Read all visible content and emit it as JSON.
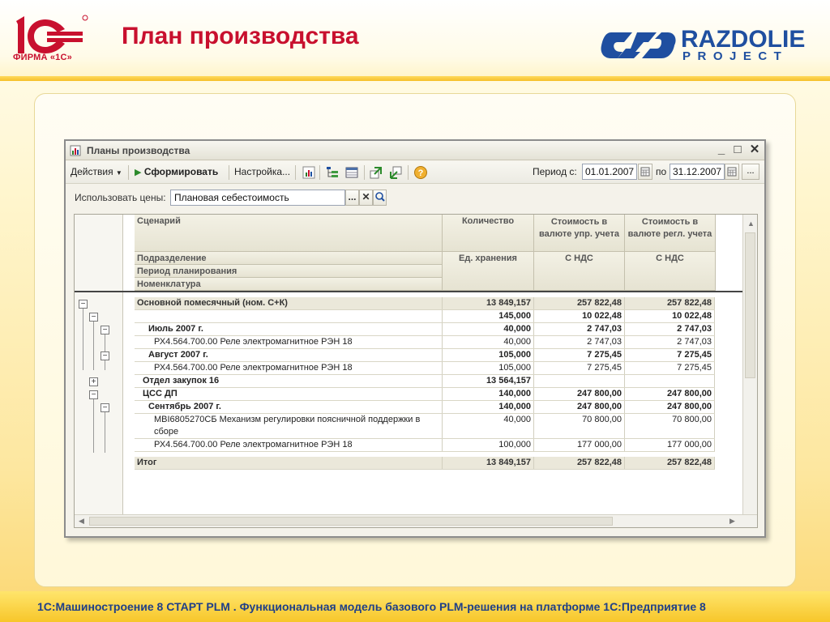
{
  "slide": {
    "brand_caption": "ФИРМА «1С»",
    "title": "План производства",
    "partner_name": "RAZDOLIE",
    "partner_sub": "PROJECT",
    "footer": "1С:Машиностроение 8 СТАРТ PLM . Функциональная модель базового PLM-решения на платформе  1С:Предприятие 8"
  },
  "window": {
    "title": "Планы производства",
    "controls": [
      "_",
      "□",
      "✕"
    ],
    "toolbar": {
      "actions": "Действия",
      "generate": "Сформировать",
      "settings": "Настройка...",
      "period_label": "Период с:",
      "date_from": "01.01.2007",
      "to_label": "по",
      "date_to": "31.12.2007",
      "more": "..."
    },
    "price": {
      "label": "Использовать цены:",
      "value": "Плановая себестоимость",
      "more": "..."
    }
  },
  "grid": {
    "headers": {
      "scenario": "Сценарий",
      "division": "Подразделение",
      "period": "Период планирования",
      "nomenclature": "Номенклатура",
      "quantity": "Количество",
      "unit": "Ед. хранения",
      "cost_mgmt": "Стоимость в валюте упр. учета",
      "cost_mgmt_vat": "С НДС",
      "cost_reg": "Стоимость в валюте регл. учета",
      "cost_reg_vat": "С НДС"
    },
    "rows": [
      {
        "name": "Основной помесячный (ном. С+К)",
        "qty": "13 849,157",
        "c1": "257 822,48",
        "c2": "257 822,48"
      },
      {
        "name": "",
        "qty": "145,000",
        "c1": "10 022,48",
        "c2": "10 022,48"
      },
      {
        "name": "Июль 2007 г.",
        "qty": "40,000",
        "c1": "2 747,03",
        "c2": "2 747,03"
      },
      {
        "name": "РХ4.564.700.00 Реле электромагнитное РЭН 18",
        "qty": "40,000",
        "c1": "2 747,03",
        "c2": "2 747,03"
      },
      {
        "name": "Август 2007 г.",
        "qty": "105,000",
        "c1": "7 275,45",
        "c2": "7 275,45"
      },
      {
        "name": "РХ4.564.700.00 Реле электромагнитное РЭН 18",
        "qty": "105,000",
        "c1": "7 275,45",
        "c2": "7 275,45"
      },
      {
        "name": "Отдел закупок 16",
        "qty": "13 564,157",
        "c1": "",
        "c2": ""
      },
      {
        "name": "ЦСС ДП",
        "qty": "140,000",
        "c1": "247 800,00",
        "c2": "247 800,00"
      },
      {
        "name": "Сентябрь 2007 г.",
        "qty": "140,000",
        "c1": "247 800,00",
        "c2": "247 800,00"
      },
      {
        "name": "МВІ6805270СБ Механизм регулировки поясничной поддержки в сборе",
        "qty": "40,000",
        "c1": "70 800,00",
        "c2": "70 800,00"
      },
      {
        "name": "РХ4.564.700.00 Реле электромагнитное РЭН 18",
        "qty": "100,000",
        "c1": "177 000,00",
        "c2": "177 000,00"
      }
    ],
    "total": {
      "name": "Итог",
      "qty": "13 849,157",
      "c1": "257 822,48",
      "c2": "257 822,48"
    }
  }
}
